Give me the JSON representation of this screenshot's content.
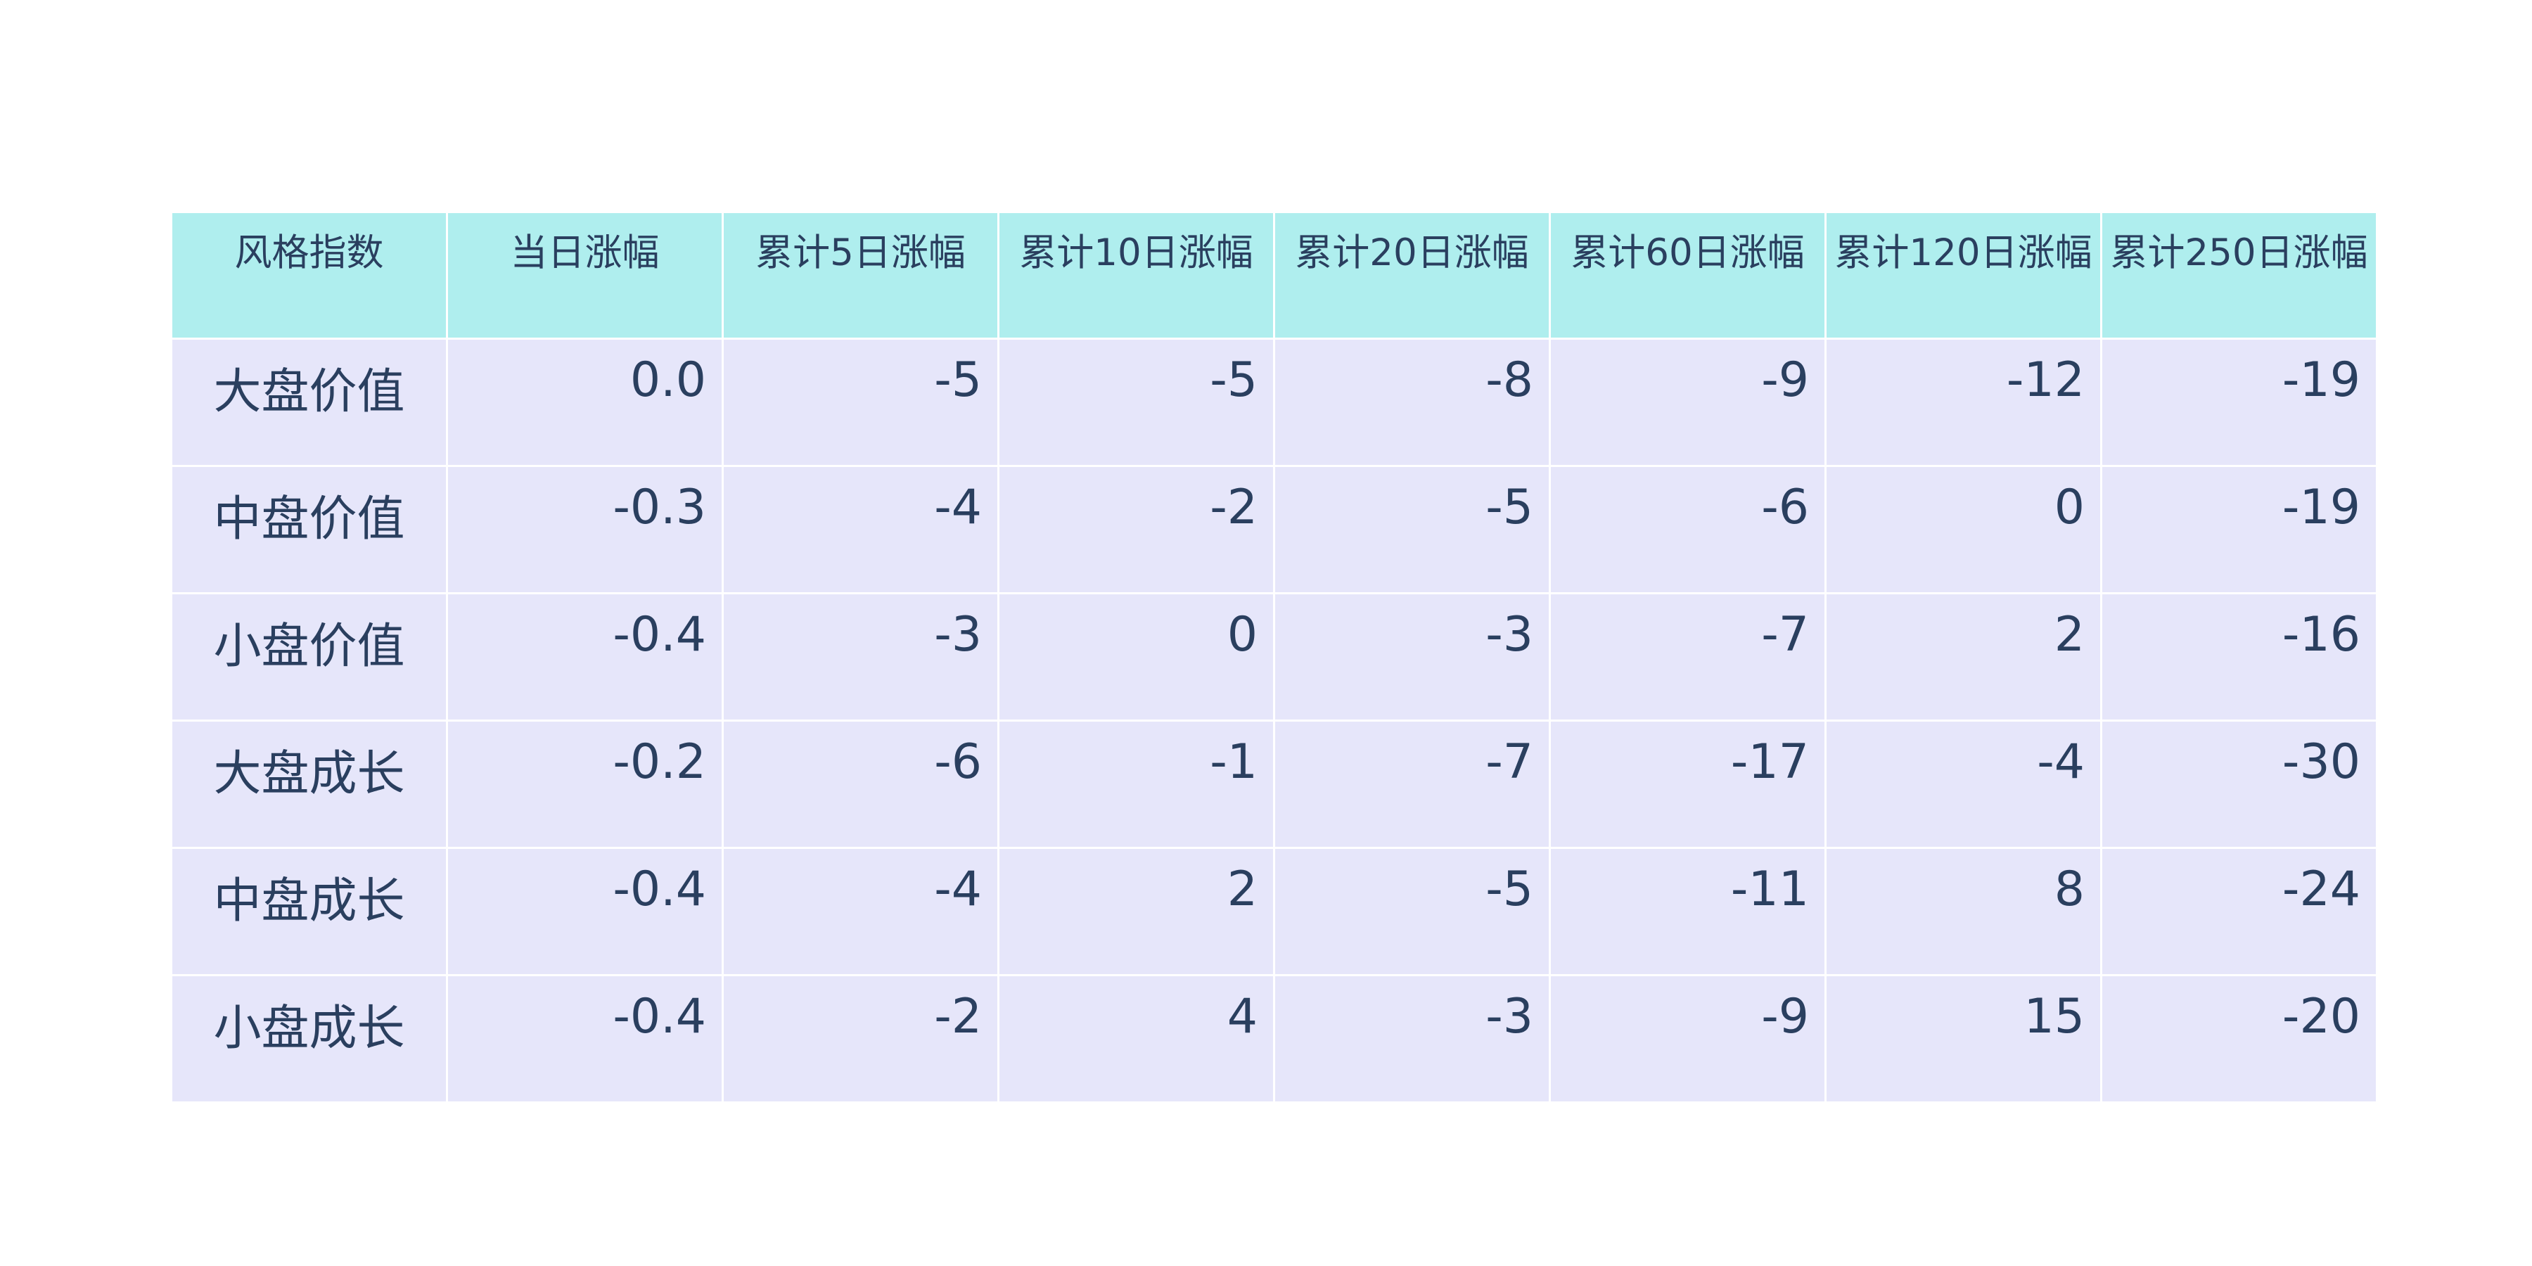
{
  "chart_data": {
    "type": "table",
    "columns": [
      "风格指数",
      "当日涨幅",
      "累计5日涨幅",
      "累计10日涨幅",
      "累计20日涨幅",
      "累计60日涨幅",
      "累计120日涨幅",
      "累计250日涨幅"
    ],
    "rows": [
      [
        "大盘价值",
        "0.0",
        "-5",
        "-5",
        "-8",
        "-9",
        "-12",
        "-19"
      ],
      [
        "中盘价值",
        "-0.3",
        "-4",
        "-2",
        "-5",
        "-6",
        "0",
        "-19"
      ],
      [
        "小盘价值",
        "-0.4",
        "-3",
        "0",
        "-3",
        "-7",
        "2",
        "-16"
      ],
      [
        "大盘成长",
        "-0.2",
        "-6",
        "-1",
        "-7",
        "-17",
        "-4",
        "-30"
      ],
      [
        "中盘成长",
        "-0.4",
        "-4",
        "2",
        "-5",
        "-11",
        "8",
        "-24"
      ],
      [
        "小盘成长",
        "-0.4",
        "-2",
        "4",
        "-3",
        "-9",
        "15",
        "-20"
      ]
    ]
  },
  "colors": {
    "header_fill": "#afeeee",
    "cell_fill": "#e6e6fa",
    "text": "#2a3f5f",
    "grid_line": "#ffffff"
  }
}
